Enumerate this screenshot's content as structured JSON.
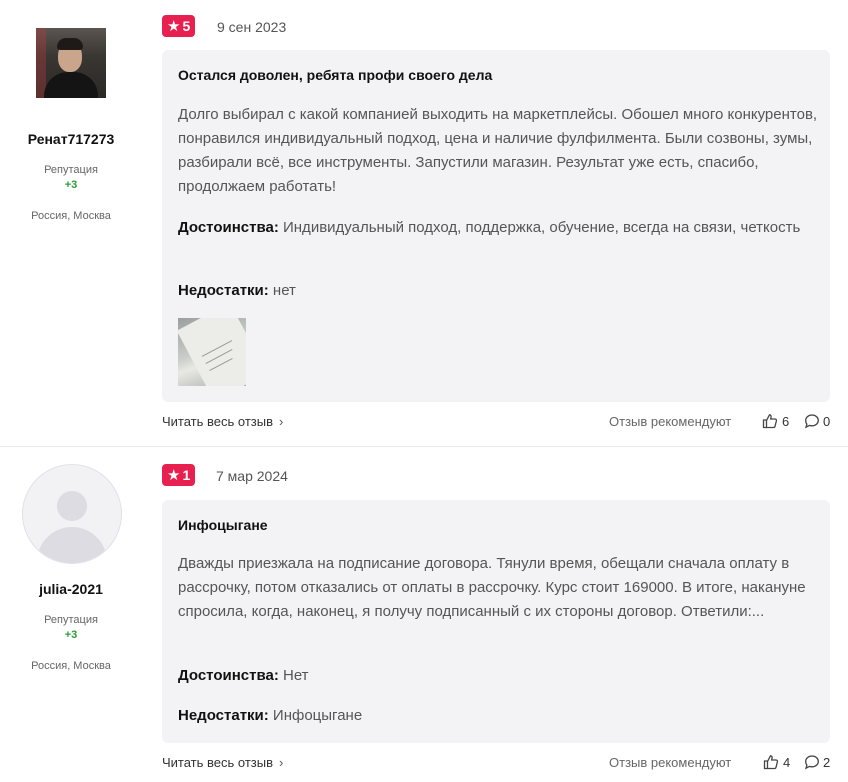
{
  "reviews": [
    {
      "username": "Ренат717273",
      "reputation_label": "Репутация",
      "reputation_value": "+3",
      "location": "Россия, Москва",
      "rating": "5",
      "date": "9 сен 2023",
      "title": "Остался доволен, ребята профи своего дела",
      "text": "Долго выбирал с какой компанией выходить на маркетплейсы. Обошел много конкурентов, понравился индивидуальный подход, цена и наличие фулфилмента. Были созвоны, зумы, разбирали всё, все инструменты. Запустили магазин. Результат уже есть, спасибо, продолжаем работать!",
      "pros_label": "Достоинства:",
      "pros": " Индивидуальный подход, поддержка, обучение, всегда на связи, четкость",
      "cons_label": "Недостатки:",
      "cons": " нет",
      "read_more": "Читать весь отзыв",
      "recommend_label": "Отзыв рекомендуют",
      "likes": "6",
      "comments": "0"
    },
    {
      "username": "julia-2021",
      "reputation_label": "Репутация",
      "reputation_value": "+3",
      "location": "Россия, Москва",
      "rating": "1",
      "date": "7 мар 2024",
      "title": "Инфоцыгане",
      "text": "Дважды приезжала на подписание договора. Тянули время, обещали сначала оплату в рассрочку, потом отказались от оплаты в рассрочку. Курс стоит 169000. В итоге, накануне спросила, когда, наконец, я получу подписанный с их стороны договор. Ответили:...",
      "pros_label": "Достоинства:",
      "pros": " Нет",
      "cons_label": "Недостатки:",
      "cons": " Инфоцыгане",
      "read_more": "Читать весь отзыв",
      "recommend_label": "Отзыв рекомендуют",
      "likes": "4",
      "comments": "2"
    }
  ],
  "colors": {
    "rating_badge": "#e8204f",
    "reputation_positive": "#2a9d3a",
    "card_background": "#f3f3f5"
  },
  "icons": {
    "rating": "star-icon",
    "read_more": "chevron-right-icon",
    "likes": "thumbs-up-icon",
    "comments": "comment-bubble-icon"
  }
}
